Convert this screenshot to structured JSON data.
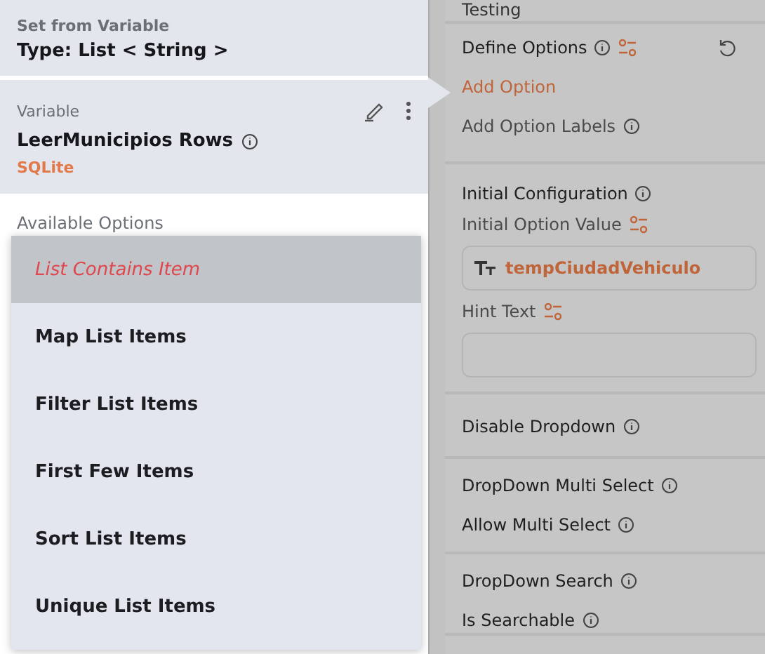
{
  "left": {
    "set_from_variable": {
      "label": "Set from Variable",
      "type": "Type: List < String >"
    },
    "variable": {
      "label": "Variable",
      "name": "LeerMunicipios Rows",
      "source": "SQLite"
    },
    "available_options_label": "Available Options",
    "menu": [
      {
        "label": "List Contains Item",
        "selected": true
      },
      {
        "label": "Map List Items",
        "selected": false
      },
      {
        "label": "Filter List Items",
        "selected": false
      },
      {
        "label": "First Few Items",
        "selected": false
      },
      {
        "label": "Sort List Items",
        "selected": false
      },
      {
        "label": "Unique List Items",
        "selected": false
      }
    ]
  },
  "right": {
    "header": "Testing",
    "sections": [
      {
        "rows": [
          {
            "kind": "heading",
            "text": "Define Options",
            "info": true,
            "var_icon": true,
            "reset": true
          },
          {
            "kind": "link",
            "text": "Add Option"
          },
          {
            "kind": "label",
            "text": "Add Option Labels",
            "info": true
          }
        ]
      },
      {
        "rows": [
          {
            "kind": "heading",
            "text": "Initial Configuration",
            "info": true
          },
          {
            "kind": "label",
            "text": "Initial Option Value",
            "var_icon": true
          },
          {
            "kind": "field",
            "value": "tempCiudadVehiculo"
          },
          {
            "kind": "label",
            "text": "Hint Text",
            "var_icon": true
          },
          {
            "kind": "field"
          }
        ]
      },
      {
        "rows": [
          {
            "kind": "heading",
            "text": "Disable Dropdown",
            "info": true
          }
        ]
      },
      {
        "rows": [
          {
            "kind": "heading",
            "text": "DropDown Multi Select",
            "info": true
          },
          {
            "kind": "heading",
            "text": "Allow Multi Select",
            "info": true
          }
        ]
      },
      {
        "rows": [
          {
            "kind": "heading",
            "text": "DropDown Search",
            "info": true
          },
          {
            "kind": "heading",
            "text": "Is Searchable",
            "info": true
          }
        ]
      }
    ]
  }
}
